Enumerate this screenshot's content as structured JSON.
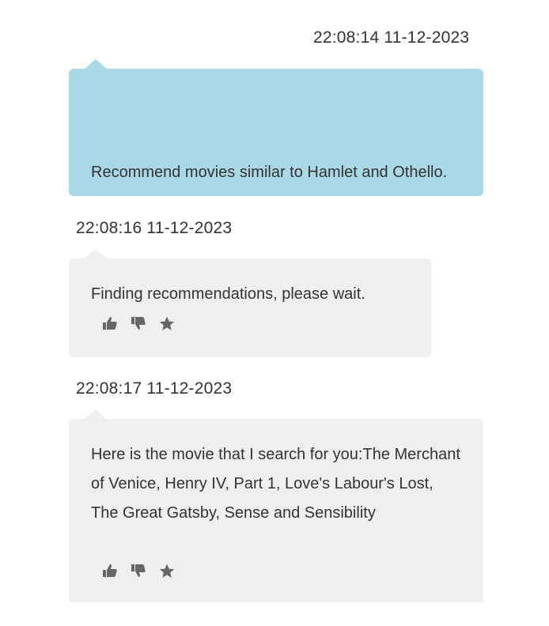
{
  "messages": [
    {
      "role": "user",
      "timestamp": "22:08:14 11-12-2023",
      "text": "Recommend movies similar to Hamlet and Othello."
    },
    {
      "role": "assistant",
      "timestamp": "22:08:16 11-12-2023",
      "text": "Finding recommendations, please wait.",
      "actions": [
        "thumbs-up-icon",
        "thumbs-down-icon",
        "star-icon"
      ]
    },
    {
      "role": "assistant",
      "timestamp": "22:08:17 11-12-2023",
      "text": "Here is the movie that I search for you:The Merchant of Venice, Henry IV, Part 1, Love's Labour's Lost, The Great Gatsby, Sense and Sensibility",
      "actions": [
        "thumbs-up-icon",
        "thumbs-down-icon",
        "star-icon"
      ]
    }
  ],
  "colors": {
    "user_bubble": "#aad8e6",
    "assistant_bubble": "#efefef",
    "icon": "#666666",
    "text": "#333333"
  }
}
